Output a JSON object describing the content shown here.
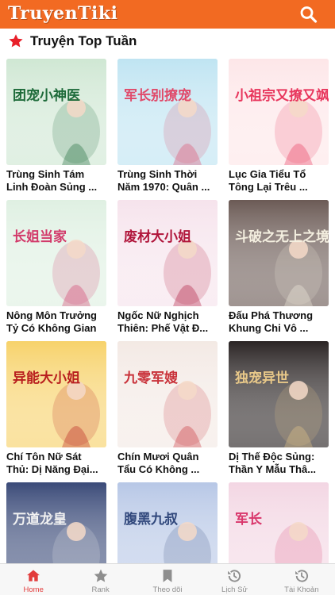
{
  "header": {
    "app_title": "TruyenTiki",
    "search_icon": "search-icon"
  },
  "section": {
    "title": "Truyện Top Tuần",
    "icon": "star-icon"
  },
  "books": [
    {
      "title": "Trùng Sinh Tám Linh Đoàn Sủng ...",
      "cover_text": "团宠小神医",
      "bg": "#cfe7d3",
      "ink": "#1e6b3a"
    },
    {
      "title": "Trùng Sinh Thời Năm 1970: Quân ...",
      "cover_text": "军长别撩宠",
      "bg": "#bfe4f2",
      "ink": "#e04a6a"
    },
    {
      "title": "Lục Gia Tiểu Tổ Tông Lại Trêu ...",
      "cover_text": "小祖宗又撩又飒",
      "bg": "#fde6e8",
      "ink": "#e8365d"
    },
    {
      "title": "Nông Môn Trưởng Tỷ Có Không Gian",
      "cover_text": "长姐当家",
      "bg": "#dff0e2",
      "ink": "#d23a6a"
    },
    {
      "title": "Ngốc Nữ Nghịch Thiên: Phế Vật Đ...",
      "cover_text": "废材大小姐",
      "bg": "#f6e3ec",
      "ink": "#b0153a"
    },
    {
      "title": "Đấu Phá Thương Khung Chi Vô ...",
      "cover_text": "斗破之无上之境",
      "bg": "#6b5a55",
      "ink": "#f4efe0"
    },
    {
      "title": "Chí Tôn Nữ Sát Thủ: Dị Năng Đại...",
      "cover_text": "异能大小姐",
      "bg": "#f7d26a",
      "ink": "#b81e1e"
    },
    {
      "title": "Chín Mươi Quân Tẩu Có Không ...",
      "cover_text": "九零军嫂",
      "bg": "#f3e9e4",
      "ink": "#c9323a"
    },
    {
      "title": "Dị Thế Độc Sủng: Thần Y Mẫu Thâ...",
      "cover_text": "独宠异世",
      "bg": "#2a2424",
      "ink": "#e8c889"
    },
    {
      "title": "",
      "cover_text": "万道龙皇",
      "bg": "#3a4a78",
      "ink": "#f2f2f2"
    },
    {
      "title": "",
      "cover_text": "腹黑九叔",
      "bg": "#b7c7e6",
      "ink": "#31487c"
    },
    {
      "title": "",
      "cover_text": "军长",
      "bg": "#f3d6e3",
      "ink": "#d9366b"
    }
  ],
  "tabs": [
    {
      "label": "Home",
      "icon": "home-icon",
      "active": true
    },
    {
      "label": "Rank",
      "icon": "star-icon",
      "active": false
    },
    {
      "label": "Theo dõi",
      "icon": "bookmark-icon",
      "active": false
    },
    {
      "label": "Lịch Sử",
      "icon": "history-icon",
      "active": false
    },
    {
      "label": "Tài Khoản",
      "icon": "account-icon",
      "active": false
    }
  ],
  "colors": {
    "brand": "#f26a22",
    "active_tab": "#e23b3b",
    "inactive_tab": "#8e8e8e"
  }
}
